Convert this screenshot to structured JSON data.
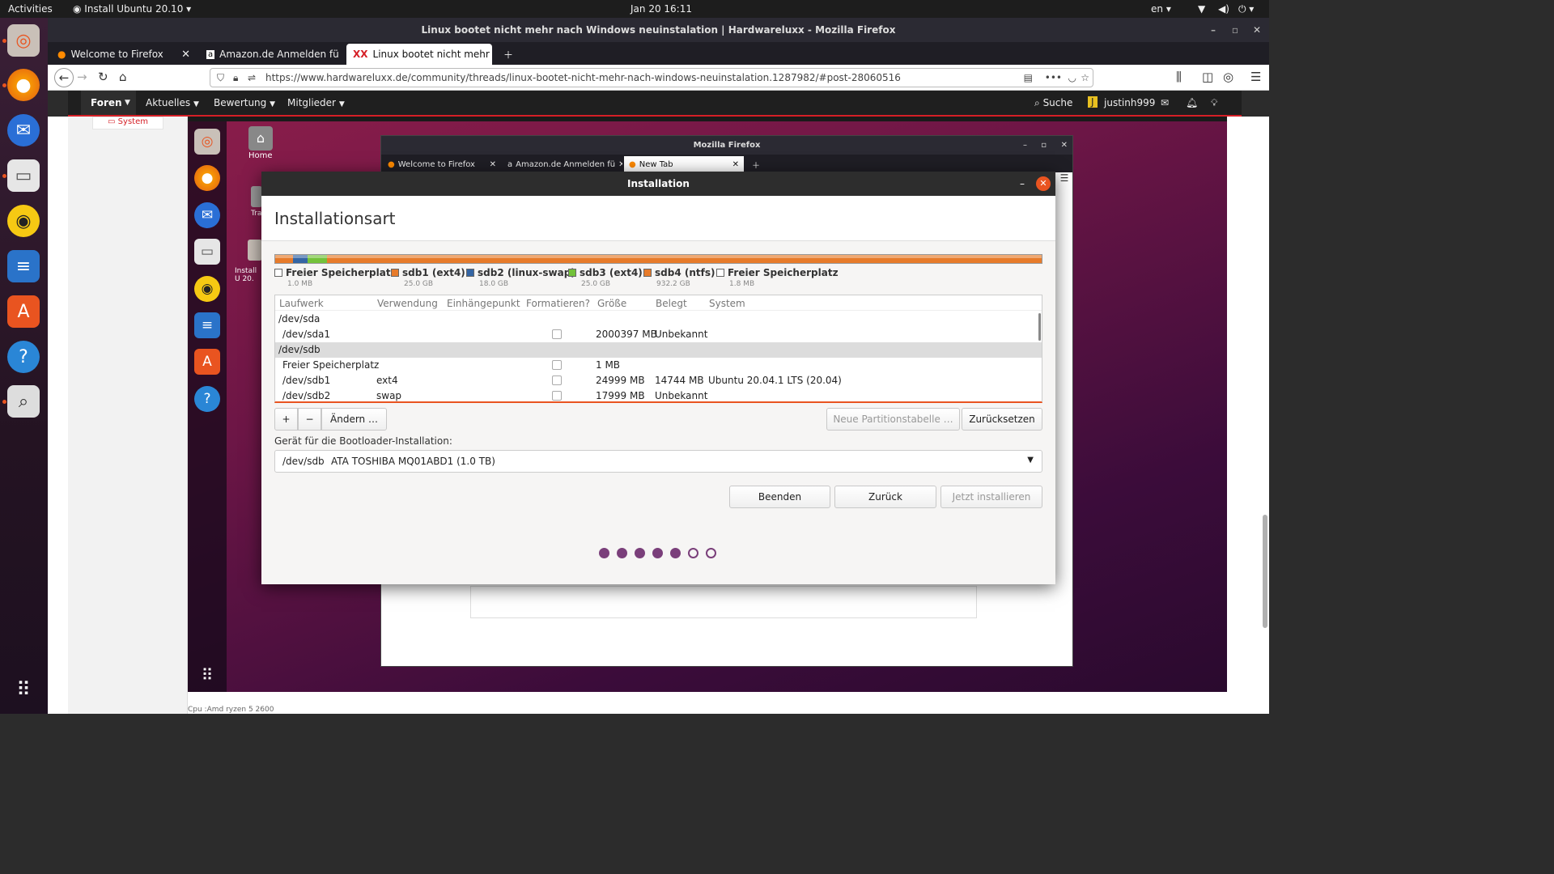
{
  "topbar": {
    "activities": "Activities",
    "app_menu": "Install Ubuntu 20.10",
    "clock": "Jan 20  16:11",
    "lang": "en"
  },
  "firefox": {
    "window_title": "Linux bootet nicht mehr nach Windows neuinstalation | Hardwareluxx - Mozilla Firefox",
    "tabs": [
      {
        "label": "Welcome to Firefox"
      },
      {
        "label": "Amazon.de Anmelden fü"
      },
      {
        "label": "Linux bootet nicht mehr"
      }
    ],
    "url": "https://www.hardwareluxx.de/community/threads/linux-bootet-nicht-mehr-nach-windows-neuinstalation.1287982/#post-28060516"
  },
  "site": {
    "nav": [
      "Foren",
      "Aktuelles",
      "Bewertung",
      "Mitglieder"
    ],
    "search": "Suche",
    "username": "justinh999",
    "avatar_letter": "J",
    "left_label": "System",
    "footer_text": "Cpu :Amd ryzen 5 2600"
  },
  "shot": {
    "desktop_icons": [
      {
        "label": "Home"
      },
      {
        "label": "Tra"
      },
      {
        "label": "Install U 20."
      }
    ],
    "inner_firefox": {
      "title": "Mozilla Firefox",
      "tabs": [
        {
          "label": "Welcome to Firefox"
        },
        {
          "label": "Amazon.de Anmelden fü"
        },
        {
          "label": "New Tab"
        }
      ]
    }
  },
  "installer": {
    "title": "Installation",
    "heading": "Installationsart",
    "legend": [
      {
        "name": "Freier Speicherplatz",
        "size": "1.0 MB",
        "color": "#ffffff"
      },
      {
        "name": "sdb1 (ext4)",
        "size": "25.0 GB",
        "color": "#e77b2a"
      },
      {
        "name": "sdb2 (linux-swap)",
        "size": "18.0 GB",
        "color": "#3465a4"
      },
      {
        "name": "sdb3 (ext4)",
        "size": "25.0 GB",
        "color": "#73c23a"
      },
      {
        "name": "sdb4 (ntfs)",
        "size": "932.2 GB",
        "color": "#e77b2a"
      },
      {
        "name": "Freier Speicherplatz",
        "size": "1.8 MB",
        "color": "#ffffff"
      }
    ],
    "columns": [
      "Laufwerk",
      "Verwendung",
      "Einhängepunkt",
      "Formatieren?",
      "Größe",
      "Belegt",
      "System"
    ],
    "rows": [
      {
        "drive": "/dev/sda",
        "use": "",
        "size": "",
        "used": "",
        "system": "",
        "header": true
      },
      {
        "drive": "/dev/sda1",
        "use": "",
        "size": "2000397 MB",
        "used": "Unbekannt",
        "system": ""
      },
      {
        "drive": "/dev/sdb",
        "use": "",
        "size": "",
        "used": "",
        "system": "",
        "header": true
      },
      {
        "drive": "Freier Speicherplatz",
        "use": "",
        "size": "1 MB",
        "used": "",
        "system": ""
      },
      {
        "drive": "/dev/sdb1",
        "use": "ext4",
        "size": "24999 MB",
        "used": "14744 MB",
        "system": "Ubuntu 20.04.1 LTS (20.04)"
      },
      {
        "drive": "/dev/sdb2",
        "use": "swap",
        "size": "17999 MB",
        "used": "Unbekannt",
        "system": ""
      }
    ],
    "add_label": "+",
    "remove_label": "−",
    "change_label": "Ändern …",
    "new_table_label": "Neue Partitionstabelle …",
    "reset_label": "Zurücksetzen",
    "bootloader_label": "Gerät für die Bootloader-Installation:",
    "bootloader_device": "/dev/sdb",
    "bootloader_desc": "ATA TOSHIBA MQ01ABD1 (1.0 TB)",
    "quit_label": "Beenden",
    "back_label": "Zurück",
    "install_label": "Jetzt installieren",
    "progress": {
      "current_step": 5,
      "total_steps": 7
    }
  }
}
